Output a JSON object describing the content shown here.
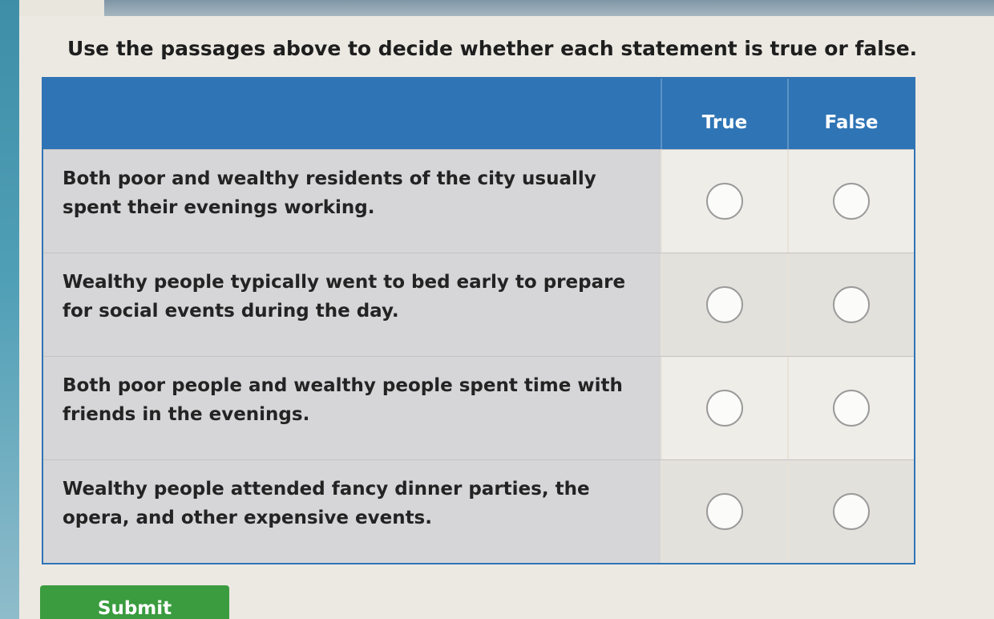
{
  "instruction": "Use the passages above to decide whether each statement is true or false.",
  "table": {
    "columns": [
      "True",
      "False"
    ],
    "rows": [
      {
        "statement": "Both poor and wealthy residents of the city usually spent their evenings working.",
        "selected": null
      },
      {
        "statement": "Wealthy people typically went to bed early to prepare for social events during the day.",
        "selected": null
      },
      {
        "statement": "Both poor people and wealthy people spent time with friends in the evenings.",
        "selected": null
      },
      {
        "statement": "Wealthy people attended fancy dinner parties, the opera, and other expensive events.",
        "selected": null
      }
    ]
  },
  "submit_label": "Submit",
  "colors": {
    "header_blue": "#2f74b5",
    "submit_green": "#3a9c3f"
  }
}
